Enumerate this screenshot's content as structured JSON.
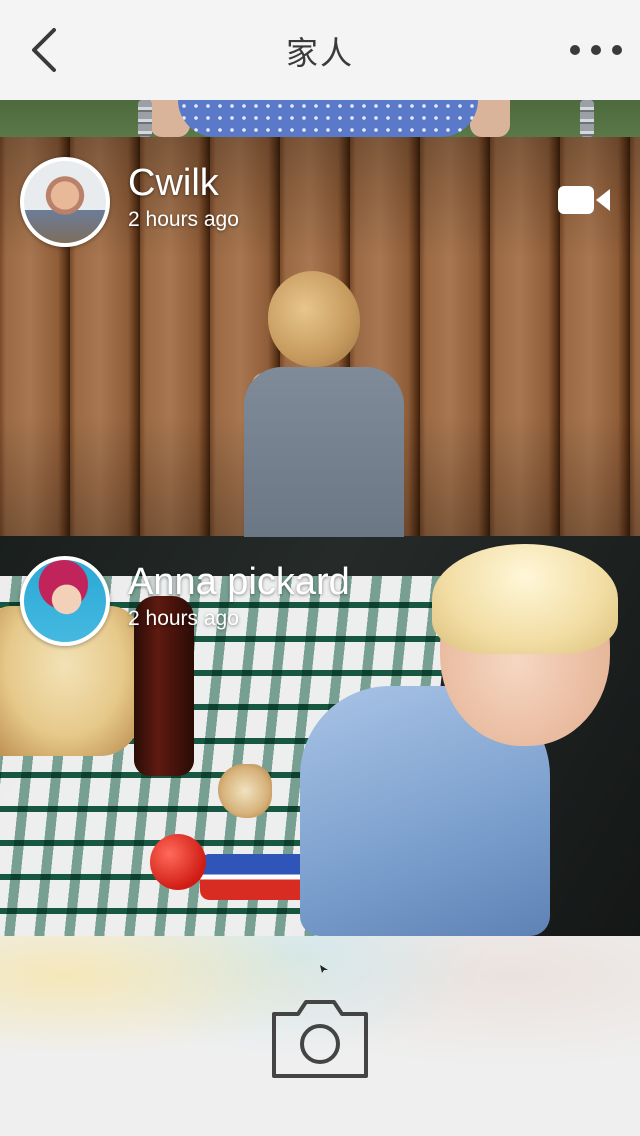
{
  "navbar": {
    "back_icon": "chevron-left-icon",
    "title": "家人",
    "more_icon": "more-dots-icon"
  },
  "posts": [
    {
      "author": "Cwilk",
      "time": "2 hours ago",
      "avatar": "avatar-cwilk",
      "media_icon": "video-camera-icon",
      "photo": "child-at-wooden-fence"
    },
    {
      "author": "Anna pickard",
      "time": "2 hours ago",
      "avatar": "avatar-anna-pickard",
      "photo": "child-at-picnic-table"
    }
  ],
  "toolbar": {
    "camera_icon": "camera-icon"
  },
  "colors": {
    "nav_background": "#f4f4f4",
    "nav_text": "#3a3a3a",
    "overlay_text": "#ffffff",
    "toolbar_icon": "#444444"
  }
}
